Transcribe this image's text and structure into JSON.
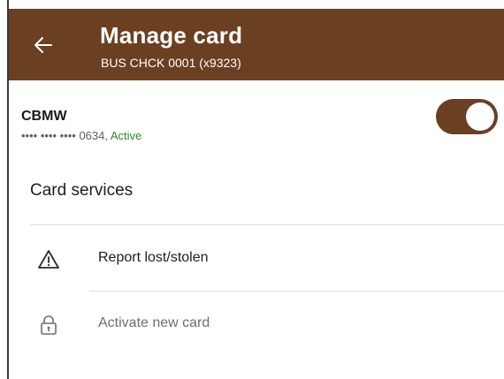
{
  "header": {
    "title": "Manage card",
    "subtitle": "BUS CHCK 0001 (x9323)",
    "back_icon": "arrow-left-icon"
  },
  "card": {
    "name": "CBMW",
    "masked_number": "•••• •••• •••• 0634,",
    "status": "Active",
    "enabled": true
  },
  "services": {
    "title": "Card services",
    "items": [
      {
        "label": "Report lost/stolen",
        "icon": "warning-icon",
        "muted": false
      },
      {
        "label": "Activate new card",
        "icon": "padlock-icon",
        "muted": true
      }
    ]
  },
  "colors": {
    "brand": "#6b3f22",
    "status_active": "#2f8a2a",
    "text_primary": "#1d1d1d",
    "text_muted": "#6e6e6e"
  }
}
